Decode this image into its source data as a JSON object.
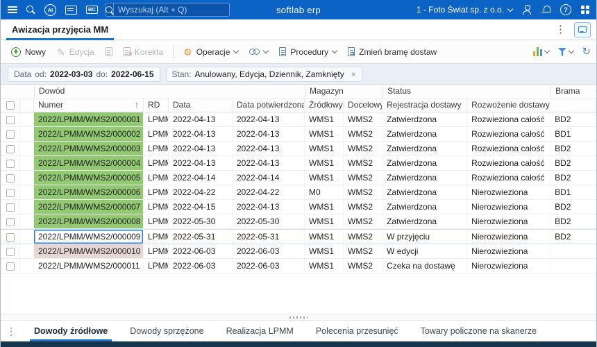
{
  "colors": {
    "topbar_blue": "#0c63c6",
    "accent_blue": "#1a73c8",
    "row_green": "#93c972",
    "row_pink": "#e7d6d6",
    "status_strip": "#16354d"
  },
  "glyphs": {
    "sort_asc": "↑",
    "close": "×",
    "more_vertical": "⋮",
    "pencil": "✎",
    "gear": "⚙",
    "refresh": "↻",
    "help": "?"
  },
  "topbar": {
    "ai_badge": "AI",
    "bc_badge": "BC",
    "search_placeholder": "Wyszukaj (Alt + Q)",
    "brand": "softlab erp",
    "company": "1 - Foto Świat sp. z o.o."
  },
  "window_tab": {
    "title": "Awizacja przyjęcia MM"
  },
  "toolbar": {
    "nowy": "Nowy",
    "edycja": "Edycja",
    "korekta": "Korekta",
    "operacje": "Operacje",
    "procedury": "Procedury",
    "zmien_brame": "Zmień bramę dostaw"
  },
  "filterbar": {
    "data_label": "Data",
    "od_label": "od:",
    "od_value": "2022-03-03",
    "do_label": "do:",
    "do_value": "2022-06-15",
    "stan_label": "Stan:",
    "stan_value": "Anulowany, Edycja, Dziennik, Zamknięty"
  },
  "table": {
    "group_headers": {
      "dowod": "Dowód",
      "magazyn": "Magazyn",
      "status": "Status",
      "brama": "Brama"
    },
    "columns": {
      "numer": "Numer",
      "rd": "RD",
      "data": "Data",
      "data_potw": "Data potwierdzona",
      "zrodlowy": "Źródłowy",
      "docelowy": "Docelowy",
      "rejestracja": "Rejestracja dostawy",
      "rozwozenie": "Rozwożenie dostawy"
    },
    "rows": [
      {
        "numer": "2022/LPMM/WMS2/000001",
        "rd": "LPMM",
        "data": "2022-04-13",
        "data_potw": "2022-04-13",
        "zrodlowy": "WMS1",
        "docelowy": "WMS2",
        "rejestracja": "Zatwierdzona",
        "rozwozenie": "Rozwieziona całość",
        "brama": "BD2",
        "state": "green"
      },
      {
        "numer": "2022/LPMM/WMS2/000002",
        "rd": "LPMM",
        "data": "2022-04-13",
        "data_potw": "2022-04-13",
        "zrodlowy": "WMS1",
        "docelowy": "WMS2",
        "rejestracja": "Zatwierdzona",
        "rozwozenie": "Rozwieziona całość",
        "brama": "BD1",
        "state": "green"
      },
      {
        "numer": "2022/LPMM/WMS2/000003",
        "rd": "LPMM",
        "data": "2022-04-13",
        "data_potw": "2022-04-13",
        "zrodlowy": "WMS1",
        "docelowy": "WMS2",
        "rejestracja": "Zatwierdzona",
        "rozwozenie": "Rozwieziona całość",
        "brama": "BD2",
        "state": "green"
      },
      {
        "numer": "2022/LPMM/WMS2/000004",
        "rd": "LPMM",
        "data": "2022-04-13",
        "data_potw": "2022-04-13",
        "zrodlowy": "WMS1",
        "docelowy": "WMS2",
        "rejestracja": "Zatwierdzona",
        "rozwozenie": "Rozwieziona całość",
        "brama": "BD2",
        "state": "green"
      },
      {
        "numer": "2022/LPMM/WMS2/000005",
        "rd": "LPMM",
        "data": "2022-04-14",
        "data_potw": "2022-04-14",
        "zrodlowy": "WMS1",
        "docelowy": "WMS2",
        "rejestracja": "Zatwierdzona",
        "rozwozenie": "Rozwieziona całość",
        "brama": "BD2",
        "state": "green"
      },
      {
        "numer": "2022/LPMM/WMS2/000006",
        "rd": "LPMM",
        "data": "2022-04-22",
        "data_potw": "2022-04-22",
        "zrodlowy": "M0",
        "docelowy": "WMS2",
        "rejestracja": "Zatwierdzona",
        "rozwozenie": "Nierozwieziona",
        "brama": "BD1",
        "state": "green"
      },
      {
        "numer": "2022/LPMM/WMS2/000007",
        "rd": "LPMM",
        "data": "2022-04-15",
        "data_potw": "2022-04-13",
        "zrodlowy": "WMS1",
        "docelowy": "WMS2",
        "rejestracja": "Zatwierdzona",
        "rozwozenie": "Nierozwieziona",
        "brama": "BD2",
        "state": "green"
      },
      {
        "numer": "2022/LPMM/WMS2/000008",
        "rd": "LPMM",
        "data": "2022-05-30",
        "data_potw": "2022-05-30",
        "zrodlowy": "WMS1",
        "docelowy": "WMS2",
        "rejestracja": "Zatwierdzona",
        "rozwozenie": "Nierozwieziona",
        "brama": "BD2",
        "state": "green"
      },
      {
        "numer": "2022/LPMM/WMS2/000009",
        "rd": "LPMM",
        "data": "2022-05-31",
        "data_potw": "2022-05-31",
        "zrodlowy": "WMS1",
        "docelowy": "WMS2",
        "rejestracja": "W przyjęciu",
        "rozwozenie": "Nierozwieziona",
        "brama": "BD2",
        "state": "selected"
      },
      {
        "numer": "2022/LPMM/WMS2/000010",
        "rd": "LPMM",
        "data": "2022-06-03",
        "data_potw": "2022-06-03",
        "zrodlowy": "WMS1",
        "docelowy": "WMS2",
        "rejestracja": "W edycji",
        "rozwozenie": "Nierozwieziona",
        "brama": "",
        "state": "pink"
      },
      {
        "numer": "2022/LPMM/WMS2/000011",
        "rd": "LPMM",
        "data": "2022-06-03",
        "data_potw": "2022-06-03",
        "zrodlowy": "WMS1",
        "docelowy": "WMS2",
        "rejestracja": "Czeka na dostawę",
        "rozwozenie": "Nierozwieziona",
        "brama": "",
        "state": "plain"
      }
    ]
  },
  "bottom_tabs": {
    "active_index": 0,
    "items": [
      "Dowody źródłowe",
      "Dowody sprzężone",
      "Realizacja LPMM",
      "Polecenia przesunięć",
      "Towary policzone na skanerze"
    ]
  }
}
